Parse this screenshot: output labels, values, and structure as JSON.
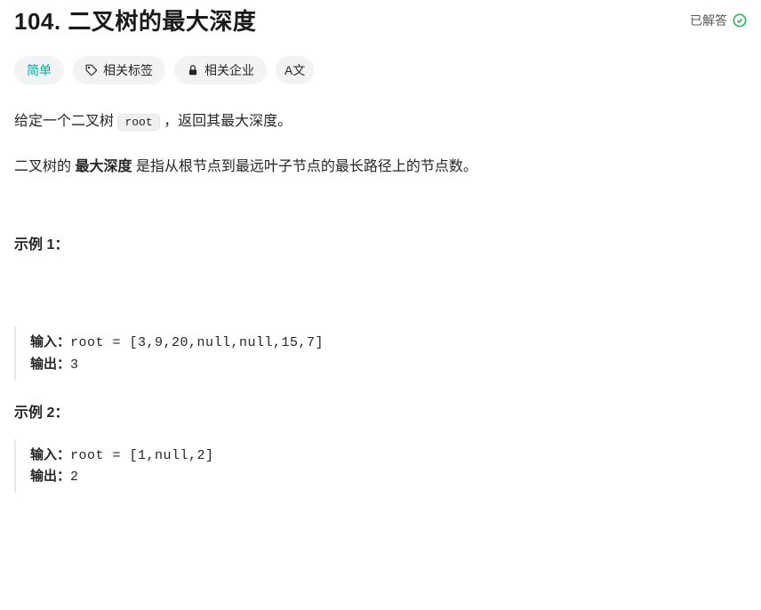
{
  "header": {
    "title": "104. 二叉树的最大深度",
    "solved_label": "已解答"
  },
  "tags": {
    "difficulty": "简单",
    "related_tags": "相关标签",
    "related_companies": "相关企业",
    "translate": "A文"
  },
  "description": {
    "line1_prefix": "给定一个二叉树 ",
    "line1_code": "root",
    "line1_suffix": " ，返回其最大深度。",
    "line2_prefix": "二叉树的 ",
    "line2_bold": "最大深度",
    "line2_suffix": " 是指从根节点到最远叶子节点的最长路径上的节点数。"
  },
  "examples": [
    {
      "title": "示例 1：",
      "input_label": "输入：",
      "input_value": "root = [3,9,20,null,null,15,7]",
      "output_label": "输出：",
      "output_value": "3"
    },
    {
      "title": "示例 2：",
      "input_label": "输入：",
      "input_value": "root = [1,null,2]",
      "output_label": "输出：",
      "output_value": "2"
    }
  ]
}
